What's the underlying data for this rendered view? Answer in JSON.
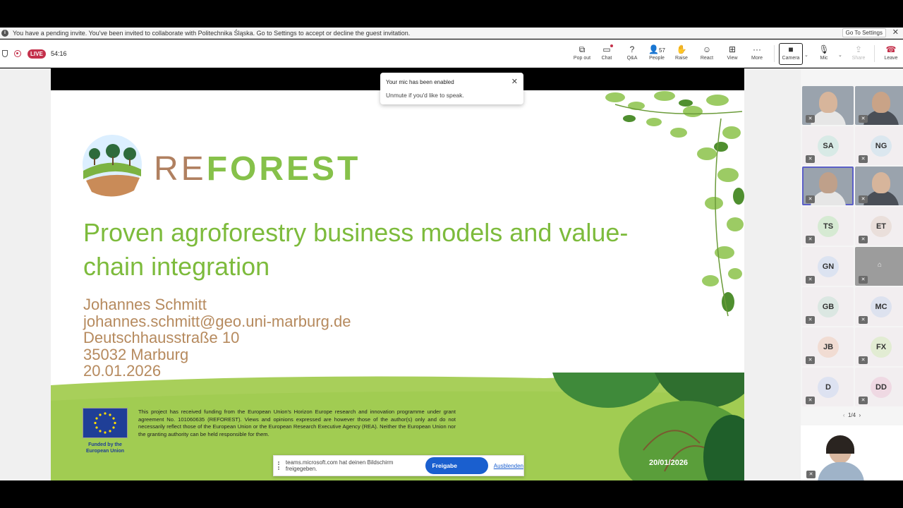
{
  "banner": {
    "message": "You have a pending invite. You've been invited to collaborate with Politechnika Śląska. Go to Settings to accept or decline the guest invitation.",
    "button": "Go To Settings"
  },
  "toolbar": {
    "live": "LIVE",
    "elapsed": "54:16",
    "buttons": {
      "popout": "Pop out",
      "chat": "Chat",
      "qa": "Q&A",
      "people": "People",
      "people_count": "57",
      "raise": "Raise",
      "react": "React",
      "view": "View",
      "more": "More",
      "camera": "Camera",
      "mic": "Mic",
      "share": "Share",
      "leave": "Leave"
    }
  },
  "toast": {
    "title": "Your mic has been enabled",
    "body": "Unmute if you'd like to speak."
  },
  "slide": {
    "brand_a": "RE",
    "brand_b": "FOREST",
    "title": "Proven agroforestry business models and value-chain integration",
    "author_lines": [
      "Johannes Schmitt",
      "johannes.schmitt@geo.uni-marburg.de",
      "Deutschhausstraße 10",
      "35032 Marburg",
      "20.01.2026"
    ],
    "eu_caption": "Funded by the European Union",
    "disclaimer": "This project has received funding from the European Union's Horizon Europe research and innovation programme under grant agreement No. 101060635 (REFOREST). Views and opinions expressed are however those of the author(s) only and do not necessarily reflect those of the European Union or the European Research Executive Agency (REA). Neither the European Union nor the granting authority can be held responsible for them.",
    "date": "20/01/2026"
  },
  "sharebar": {
    "message": "teams.microsoft.com hat deinen Bildschirm freigegeben.",
    "stop": "Freigabe beenden",
    "hide": "Ausblenden"
  },
  "participants": [
    {
      "initials": "",
      "video": true
    },
    {
      "initials": "",
      "video": true
    },
    {
      "initials": "SA",
      "color": "#d8eae6"
    },
    {
      "initials": "NG",
      "color": "#dbe7ef"
    },
    {
      "initials": "",
      "video": true,
      "selected": true
    },
    {
      "initials": "",
      "video": true
    },
    {
      "initials": "TS",
      "color": "#d6ead3"
    },
    {
      "initials": "ET",
      "color": "#eadfdb"
    },
    {
      "initials": "GN",
      "color": "#dce3f1"
    },
    {
      "initials": "",
      "video": true,
      "grey": true
    },
    {
      "initials": "GB",
      "color": "#dbe7e2"
    },
    {
      "initials": "MC",
      "color": "#dde2ef"
    },
    {
      "initials": "JB",
      "color": "#f1dcd3"
    },
    {
      "initials": "FX",
      "color": "#e2ecd3"
    },
    {
      "initials": "D",
      "color": "#dde2f1"
    },
    {
      "initials": "DD",
      "color": "#efd9e3"
    }
  ],
  "pager": {
    "text": "1/4"
  },
  "colors": {
    "accent": "#5b5fc7",
    "live": "#c4314b",
    "slide_green": "#7dbb3c",
    "slide_brown": "#b68a5e"
  }
}
